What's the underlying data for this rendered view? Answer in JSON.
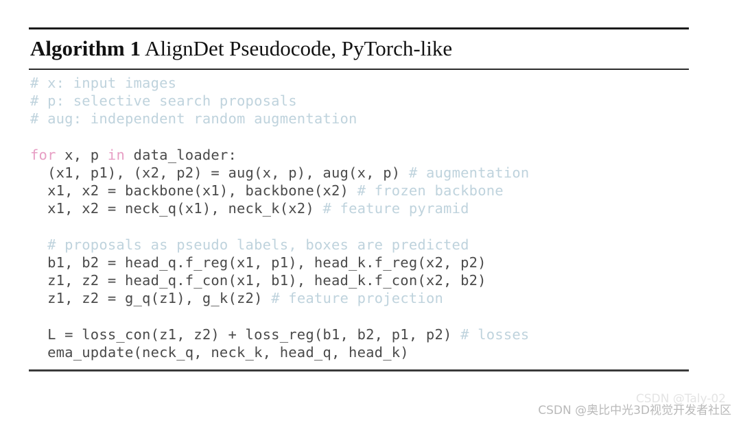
{
  "figure": {
    "title_strong": "Algorithm 1",
    "title_rest": " AlignDet Pseudocode, PyTorch-like",
    "colors": {
      "comment": "#bfd3dd",
      "keyword": "#e79ec4",
      "code": "#4a4a4a",
      "rule": "#1a1a1a",
      "background": "#ffffff"
    },
    "code_lines": [
      {
        "id": "comment-x",
        "tokens": [
          {
            "type": "comment",
            "text": "# x: input images"
          }
        ]
      },
      {
        "id": "comment-p",
        "tokens": [
          {
            "type": "comment",
            "text": "# p: selective search proposals"
          }
        ]
      },
      {
        "id": "comment-aug",
        "tokens": [
          {
            "type": "comment",
            "text": "# aug: independent random augmentation"
          }
        ]
      },
      {
        "id": "blank-1",
        "tokens": []
      },
      {
        "id": "for-loop",
        "tokens": [
          {
            "type": "keyword",
            "text": "for"
          },
          {
            "type": "code",
            "text": " x, p "
          },
          {
            "type": "keyword",
            "text": "in"
          },
          {
            "type": "code",
            "text": " data_loader:"
          }
        ]
      },
      {
        "id": "augmentation",
        "tokens": [
          {
            "type": "code",
            "text": "  (x1, p1), (x2, p2) = aug(x, p), aug(x, p) "
          },
          {
            "type": "comment",
            "text": "# augmentation"
          }
        ]
      },
      {
        "id": "backbone",
        "tokens": [
          {
            "type": "code",
            "text": "  x1, x2 = backbone(x1), backbone(x2) "
          },
          {
            "type": "comment",
            "text": "# frozen backbone"
          }
        ]
      },
      {
        "id": "neck",
        "tokens": [
          {
            "type": "code",
            "text": "  x1, x2 = neck_q(x1), neck_k(x2) "
          },
          {
            "type": "comment",
            "text": "# feature pyramid"
          }
        ]
      },
      {
        "id": "blank-2",
        "tokens": []
      },
      {
        "id": "comment-proposals",
        "tokens": [
          {
            "type": "comment",
            "text": "  # proposals as pseudo labels, boxes are predicted"
          }
        ]
      },
      {
        "id": "boxes",
        "tokens": [
          {
            "type": "code",
            "text": "  b1, b2 = head_q.f_reg(x1, p1), head_k.f_reg(x2, p2)"
          }
        ]
      },
      {
        "id": "contrast",
        "tokens": [
          {
            "type": "code",
            "text": "  z1, z2 = head_q.f_con(x1, b1), head_k.f_con(x2, b2)"
          }
        ]
      },
      {
        "id": "projection",
        "tokens": [
          {
            "type": "code",
            "text": "  z1, z2 = g_q(z1), g_k(z2) "
          },
          {
            "type": "comment",
            "text": "# feature projection"
          }
        ]
      },
      {
        "id": "blank-3",
        "tokens": []
      },
      {
        "id": "loss",
        "tokens": [
          {
            "type": "code",
            "text": "  L = loss_con(z1, z2) + loss_reg(b1, b2, p1, p2) "
          },
          {
            "type": "comment",
            "text": "# losses"
          }
        ]
      },
      {
        "id": "ema-update",
        "tokens": [
          {
            "type": "code",
            "text": "  ema_update(neck_q, neck_k, head_q, head_k)"
          }
        ]
      }
    ]
  },
  "watermarks": {
    "main": "CSDN @奥比中光3D视觉开发者社区",
    "ghost": "CSDN @Taly-02"
  }
}
